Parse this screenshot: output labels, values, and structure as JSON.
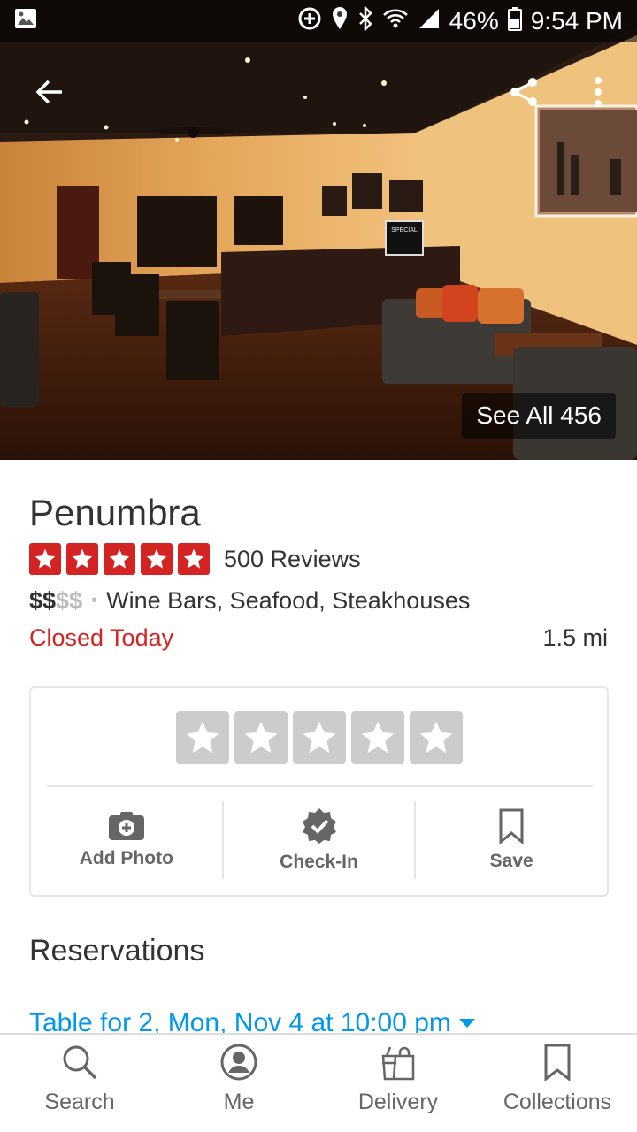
{
  "status_bar": {
    "battery": "46%",
    "time": "9:54 PM"
  },
  "hero": {
    "see_all_label": "See All 456",
    "sign_text": "SPECIAL"
  },
  "business": {
    "name": "Penumbra",
    "rating": 5,
    "reviews_label": "500 Reviews",
    "price_active": "$$",
    "price_inactive": "$$",
    "separator": "•",
    "categories": "Wine Bars, Seafood, Steakhouses",
    "status": "Closed Today",
    "distance": "1.5 mi"
  },
  "actions": {
    "add_photo": "Add Photo",
    "check_in": "Check-In",
    "save": "Save"
  },
  "reservations": {
    "title": "Reservations",
    "link": "Table for 2, Mon, Nov 4 at 10:00 pm"
  },
  "bottom_nav": {
    "search": "Search",
    "me": "Me",
    "delivery": "Delivery",
    "collections": "Collections"
  },
  "colors": {
    "brand_red": "#d32323",
    "link_blue": "#0097ec"
  }
}
